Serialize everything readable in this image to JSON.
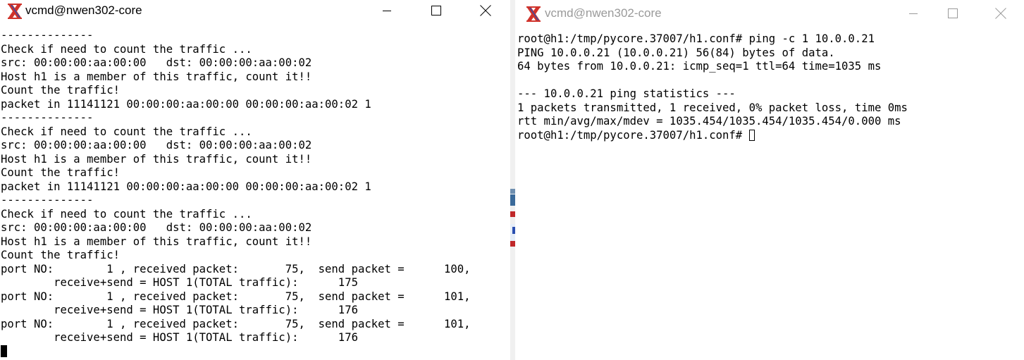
{
  "colors": {
    "icon_red": "#d0322a",
    "icon_blue": "#2a4fb0",
    "inactive_title": "#9a9a9a",
    "gap_blue": "#3a6a9a",
    "gap_red": "#c0282a"
  },
  "left_window": {
    "title": "vcmd@nwen302-core",
    "icon": "core-x-icon",
    "controls": [
      "minimize-icon",
      "maximize-icon",
      "close-icon"
    ],
    "lines": [
      "--------------",
      "Check if need to count the traffic ...",
      "src: 00:00:00:aa:00:00   dst: 00:00:00:aa:00:02",
      "Host h1 is a member of this traffic, count it!!",
      "Count the traffic!",
      "packet in 11141121 00:00:00:aa:00:00 00:00:00:aa:00:02 1",
      "--------------",
      "Check if need to count the traffic ...",
      "src: 00:00:00:aa:00:00   dst: 00:00:00:aa:00:02",
      "Host h1 is a member of this traffic, count it!!",
      "Count the traffic!",
      "packet in 11141121 00:00:00:aa:00:00 00:00:00:aa:00:02 1",
      "--------------",
      "Check if need to count the traffic ...",
      "src: 00:00:00:aa:00:00   dst: 00:00:00:aa:00:02",
      "Host h1 is a member of this traffic, count it!!",
      "Count the traffic!",
      "port NO:        1 , received packet:       75,  send packet =      100,",
      "        receive+send = HOST 1(TOTAL traffic):      175",
      "port NO:        1 , received packet:       75,  send packet =      101,",
      "        receive+send = HOST 1(TOTAL traffic):      176",
      "port NO:        1 , received packet:       75,  send packet =      101,",
      "        receive+send = HOST 1(TOTAL traffic):      176"
    ]
  },
  "right_window": {
    "title": "vcmd@nwen302-core",
    "icon": "core-x-icon",
    "controls": [
      "minimize-icon",
      "maximize-icon",
      "close-icon"
    ],
    "lines": [
      "root@h1:/tmp/pycore.37007/h1.conf# ping -c 1 10.0.0.21",
      "PING 10.0.0.21 (10.0.0.21) 56(84) bytes of data.",
      "64 bytes from 10.0.0.21: icmp_seq=1 ttl=64 time=1035 ms",
      "",
      "--- 10.0.0.21 ping statistics ---",
      "1 packets transmitted, 1 received, 0% packet loss, time 0ms",
      "rtt min/avg/max/mdev = 1035.454/1035.454/1035.454/0.000 ms"
    ],
    "prompt": "root@h1:/tmp/pycore.37007/h1.conf# "
  }
}
